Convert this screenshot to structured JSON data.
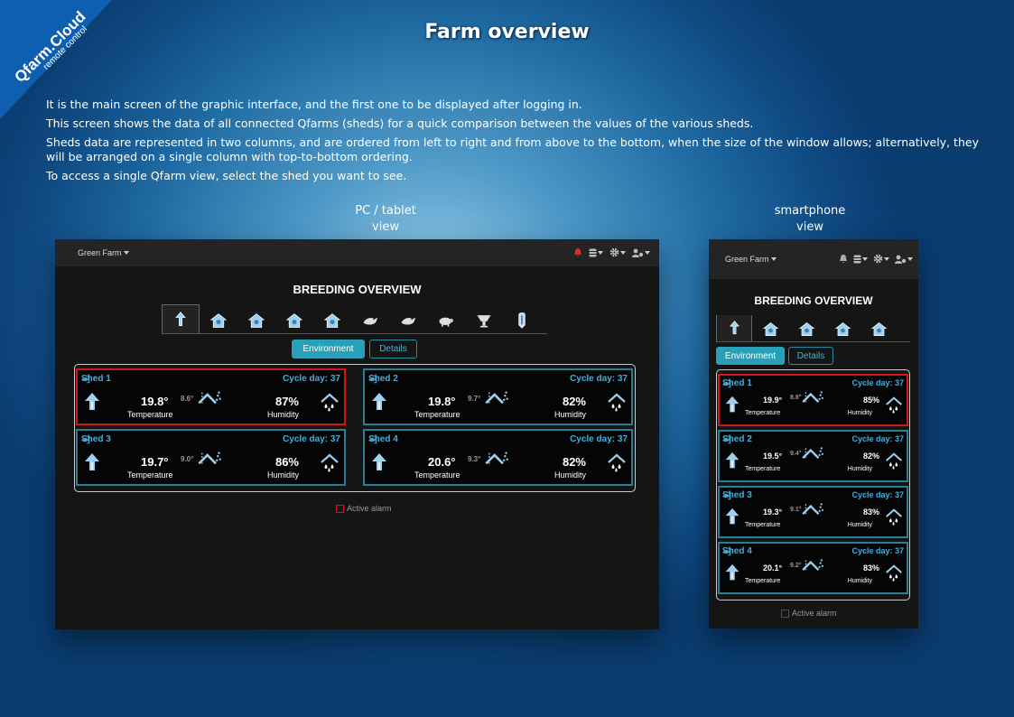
{
  "brand": {
    "name": "Qfarm.Cloud",
    "tagline": "remote control"
  },
  "page_title": "Farm overview",
  "intro": [
    "It is the main screen of the graphic interface, and the first one to be displayed after logging in.",
    "This screen shows the data of all connected Qfarms (sheds) for a quick comparison between the values of the various sheds.",
    "Sheds data are represented in two columns, and are ordered from left to right and from above to the bottom, when the size of the window allows; alternatively, they will be arranged on a single column with top-to-bottom ordering.",
    "To access a single Qfarm view, select the shed you want to see."
  ],
  "labels": {
    "pc": "PC / tablet",
    "pc2": "view",
    "phone": "smartphone",
    "phone2": "view"
  },
  "app": {
    "farm": "Green Farm",
    "overview_title": "BREEDING OVERVIEW",
    "env_button": "Environment",
    "details_button": "Details",
    "legend": "Active alarm",
    "accent": "#2aa0b8",
    "alarm_color": "#d01818"
  },
  "pc_sheds": [
    {
      "name": "Shed 1",
      "cycle": "Cycle day: 37",
      "temp": "19.8°",
      "ext": "8.6°",
      "hum": "87%",
      "temp_label": "Temperature",
      "hum_label": "Humidity",
      "alarm": true
    },
    {
      "name": "Shed 2",
      "cycle": "Cycle day: 37",
      "temp": "19.8°",
      "ext": "9.7°",
      "hum": "82%",
      "temp_label": "Temperature",
      "hum_label": "Humidity",
      "alarm": false
    },
    {
      "name": "Shed 3",
      "cycle": "Cycle day: 37",
      "temp": "19.7°",
      "ext": "9.0°",
      "hum": "86%",
      "temp_label": "Temperature",
      "hum_label": "Humidity",
      "alarm": false
    },
    {
      "name": "Shed 4",
      "cycle": "Cycle day: 37",
      "temp": "20.6°",
      "ext": "9.3°",
      "hum": "82%",
      "temp_label": "Temperature",
      "hum_label": "Humidity",
      "alarm": false
    }
  ],
  "phone_sheds": [
    {
      "name": "Shed 1",
      "cycle": "Cycle day: 37",
      "temp": "19.9°",
      "ext": "8.8°",
      "hum": "85%",
      "temp_label": "Temperature",
      "hum_label": "Humidity",
      "alarm": true
    },
    {
      "name": "Shed 2",
      "cycle": "Cycle day: 37",
      "temp": "19.5°",
      "ext": "9.4°",
      "hum": "82%",
      "temp_label": "Temperature",
      "hum_label": "Humidity",
      "alarm": false
    },
    {
      "name": "Shed 3",
      "cycle": "Cycle day: 37",
      "temp": "19.3°",
      "ext": "9.1°",
      "hum": "83%",
      "temp_label": "Temperature",
      "hum_label": "Humidity",
      "alarm": false
    },
    {
      "name": "Shed 4",
      "cycle": "Cycle day: 37",
      "temp": "20.1°",
      "ext": "9.2°",
      "hum": "83%",
      "temp_label": "Temperature",
      "hum_label": "Humidity",
      "alarm": false
    }
  ],
  "pc_tab_icons": [
    "thermometer-icon",
    "shed-icon",
    "shed-icon",
    "shed-icon",
    "shed-icon",
    "bird-icon",
    "bird-icon",
    "pig-icon",
    "feeder-icon",
    "silo-icon"
  ],
  "phone_tab_icons": [
    "thermometer-icon",
    "shed-icon",
    "shed-icon",
    "shed-icon",
    "shed-icon"
  ]
}
